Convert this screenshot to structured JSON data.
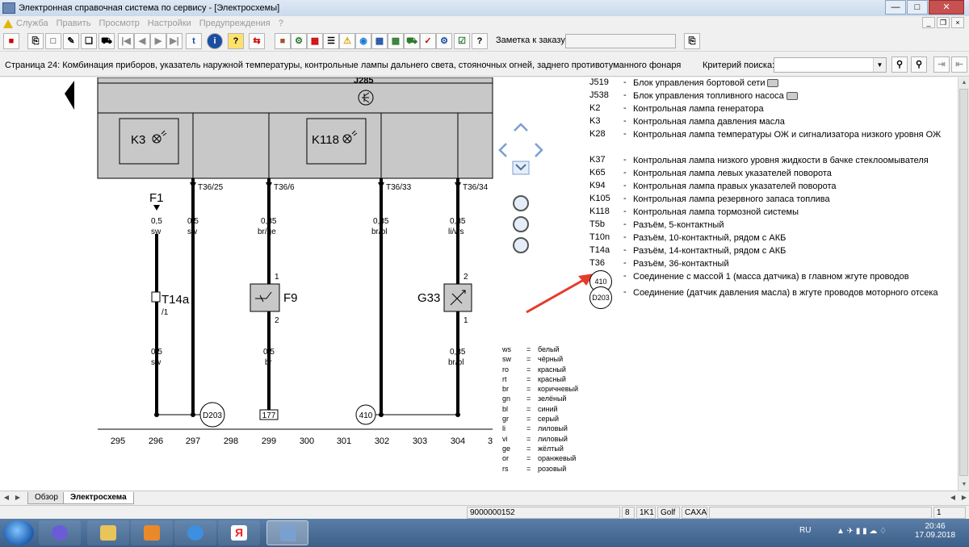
{
  "window": {
    "title": "Электронная справочная система по сервису - [Электросхемы]"
  },
  "menu": {
    "items": [
      "Служба",
      "Править",
      "Просмотр",
      "Настройки",
      "Предупреждения",
      "?"
    ]
  },
  "toolbar": {
    "order_label": "Заметка к заказу:",
    "order_value": ""
  },
  "pagebar": {
    "page_title": "Страница 24: Комбинация приборов, указатель наружной температуры, контрольные лампы дальнего света, стояночных огней, заднего противотуманного фонаря и",
    "criteria_label": "Критерий поиска:",
    "criteria_value": ""
  },
  "schematic": {
    "top_label": "J285",
    "comp_k3": "K3",
    "comp_k118": "K118",
    "comp_f1": "F1",
    "comp_t14a": "T14a",
    "comp_t14a_pin": "/1",
    "comp_f9": "F9",
    "comp_g33": "G33",
    "pins": [
      "T36/25",
      "T36/6",
      "T36/33",
      "T36/34"
    ],
    "wire_f1_top": [
      "0,5",
      "sw"
    ],
    "wire_297_top": [
      "0,5",
      "sw"
    ],
    "wire_299_top": [
      "0,35",
      "br/ge"
    ],
    "wire_302_top": [
      "0,35",
      "br/bl"
    ],
    "wire_304_top": [
      "0,35",
      "li/ws"
    ],
    "wire_f1_bottom": [
      "0,5",
      "sw"
    ],
    "wire_299_bottom": [
      "0,5",
      "br"
    ],
    "wire_304_bottom": [
      "0,35",
      "br/bl"
    ],
    "f9_pin_top": "1",
    "f9_pin_bottom": "2",
    "g33_pin_top": "2",
    "g33_pin_bottom": "1",
    "ground_d203": "D203",
    "ref_177": "177",
    "ground_410": "410",
    "track_numbers": [
      "295",
      "296",
      "297",
      "298",
      "299",
      "300",
      "301",
      "302",
      "303",
      "304",
      "3"
    ]
  },
  "legend": [
    {
      "code": "J519",
      "dash": "-",
      "desc": "Блок управления бортовой сети",
      "camera": true
    },
    {
      "code": "J538",
      "dash": "-",
      "desc": "Блок управления топливного насоса",
      "camera": true
    },
    {
      "code": "K2",
      "dash": "-",
      "desc": "Контрольная лампа генератора"
    },
    {
      "code": "K3",
      "dash": "-",
      "desc": "Контрольная лампа давления масла"
    },
    {
      "code": "K28",
      "dash": "-",
      "desc": "Контрольная лампа температуры ОЖ и сигнализатора низкого уровня ОЖ",
      "tall": true
    },
    {
      "code": "K37",
      "dash": "-",
      "desc": "Контрольная лампа низкого уровня жидкости в бачке стеклоомывателя"
    },
    {
      "code": "K65",
      "dash": "-",
      "desc": "Контрольная лампа левых указателей поворота"
    },
    {
      "code": "K94",
      "dash": "-",
      "desc": "Контрольная лампа правых указателей поворота"
    },
    {
      "code": "K105",
      "dash": "-",
      "desc": "Контрольная лампа резервного запаса топлива"
    },
    {
      "code": "K118",
      "dash": "-",
      "desc": "Контрольная лампа тормозной системы"
    },
    {
      "code": "T5b",
      "dash": "-",
      "desc": "Разъём, 5-контактный"
    },
    {
      "code": "T10n",
      "dash": "-",
      "desc": "Разъём, 10-контактный, рядом с АКБ"
    },
    {
      "code": "T14a",
      "dash": "-",
      "desc": "Разъём, 14-контактный, рядом с АКБ"
    },
    {
      "code": "T36",
      "dash": "-",
      "desc": "Разъём, 36-контактный"
    },
    {
      "code": "410",
      "dash": "-",
      "desc": "Соединение с массой 1 (масса датчика) в главном жгуте проводов",
      "circle": true
    },
    {
      "code": "D203",
      "dash": "-",
      "desc": "Соединение (датчик давления масла) в жгуте проводов моторного отсека",
      "circle": true,
      "tall": true
    }
  ],
  "wire_colors": [
    [
      "ws",
      "=",
      "белый"
    ],
    [
      "sw",
      "=",
      "чёрный"
    ],
    [
      "ro",
      "=",
      "красный"
    ],
    [
      "rt",
      "=",
      "красный"
    ],
    [
      "br",
      "=",
      "коричневый"
    ],
    [
      "gn",
      "=",
      "зелёный"
    ],
    [
      "bl",
      "=",
      "синий"
    ],
    [
      "gr",
      "=",
      "серый"
    ],
    [
      "li",
      "=",
      "лиловый"
    ],
    [
      "vi",
      "=",
      "лиловый"
    ],
    [
      "ge",
      "=",
      "жёлтый"
    ],
    [
      "or",
      "=",
      "оранжевый"
    ],
    [
      "rs",
      "=",
      "розовый"
    ]
  ],
  "tabs": [
    "Обзор",
    "Электросхема"
  ],
  "status": {
    "doc_number": "9000000152",
    "cell1": "8",
    "cell2": "1K1",
    "cell3": "Golf",
    "cell4": "CAXA",
    "page": "1"
  },
  "taskbar": {
    "lang": "RU",
    "time": "20:46",
    "date": "17.09.2018"
  },
  "colors": {
    "arrow": "#e53b2c",
    "schematic_band": "#c8c8c8",
    "taskbar": "#3c5f88"
  }
}
